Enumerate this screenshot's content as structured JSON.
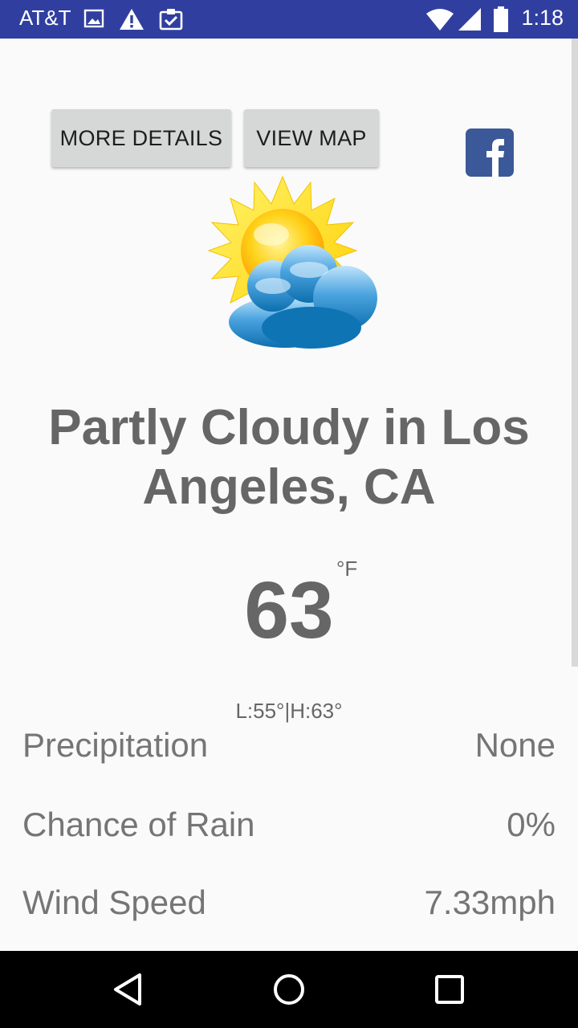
{
  "status_bar": {
    "carrier": "AT&T",
    "time": "1:18",
    "icons": [
      "image-icon",
      "warning-icon",
      "clipboard-check-icon",
      "wifi-icon",
      "cell-signal-icon",
      "battery-icon"
    ]
  },
  "toolbar": {
    "more_details_label": "MORE DETAILS",
    "view_map_label": "VIEW MAP",
    "share_icon": "facebook-icon"
  },
  "weather": {
    "icon": "partly-cloudy-icon",
    "condition_title": "Partly Cloudy in Los Angeles, CA",
    "temperature": "63",
    "unit": "°F",
    "low_high": "L:55°|H:63°"
  },
  "details": [
    {
      "label": "Precipitation",
      "value": "None"
    },
    {
      "label": "Chance of Rain",
      "value": "0%"
    },
    {
      "label": "Wind Speed",
      "value": "7.33mph"
    }
  ],
  "nav": {
    "icons": [
      "back-icon",
      "home-icon",
      "recents-icon"
    ]
  },
  "colors": {
    "status_bar": "#303f9f",
    "background": "#fafafa",
    "text": "#666666",
    "button": "#d6d7d7",
    "facebook": "#3b5998"
  }
}
